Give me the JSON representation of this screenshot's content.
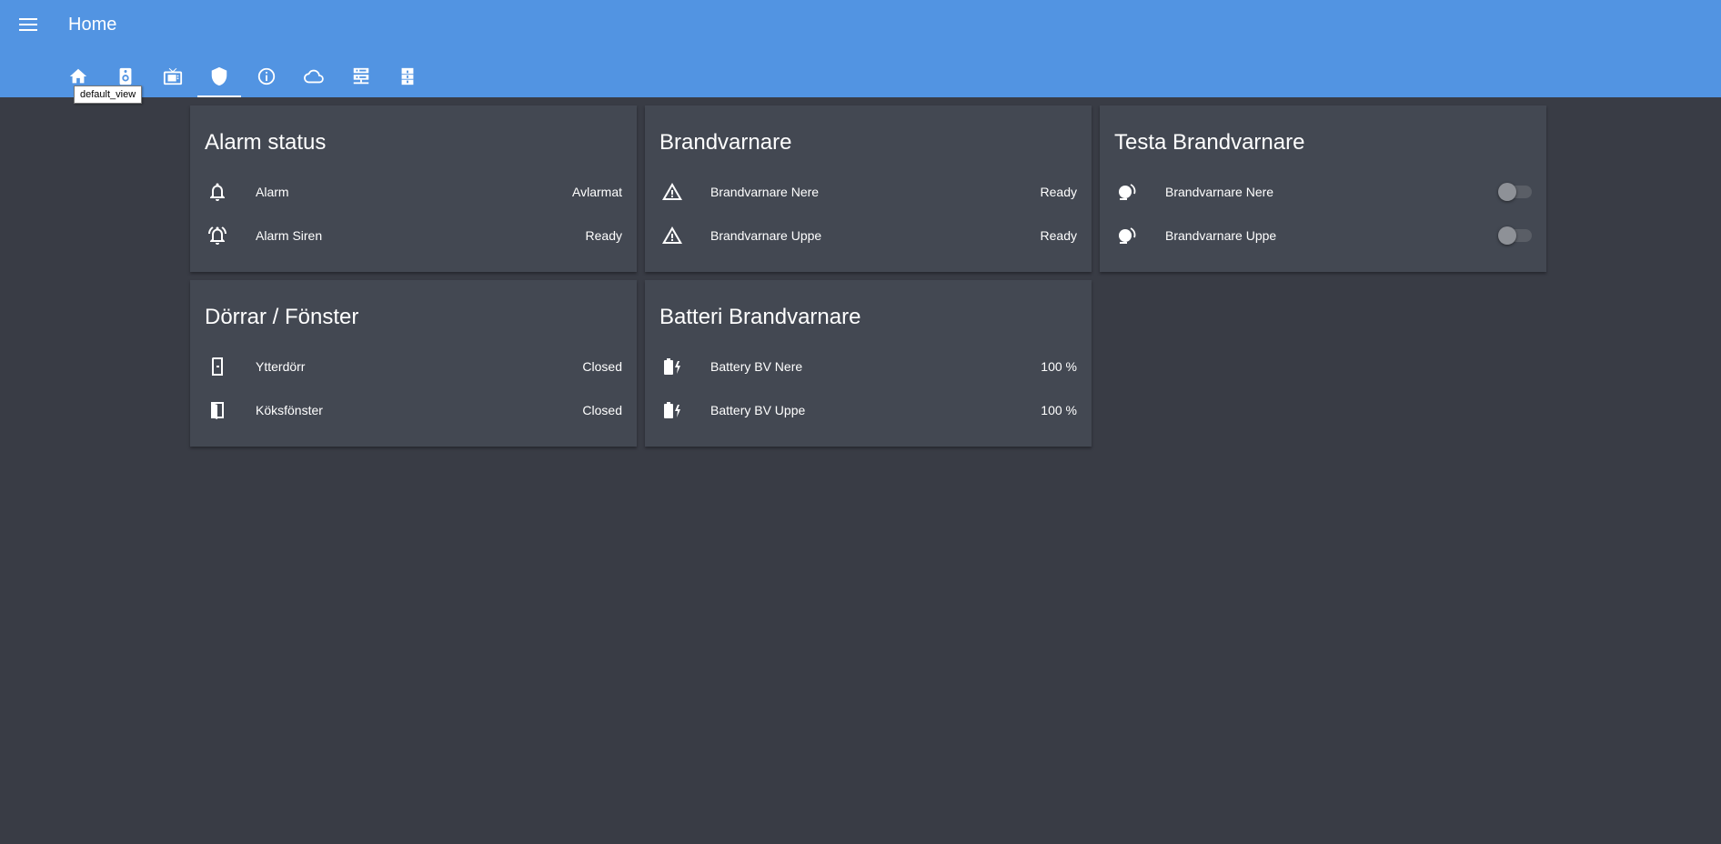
{
  "header": {
    "title": "Home",
    "menu_icon": "menu-icon",
    "tabs": [
      {
        "icon": "home-icon"
      },
      {
        "icon": "speaker-icon"
      },
      {
        "icon": "tv-icon"
      },
      {
        "icon": "shield-icon",
        "active": true
      },
      {
        "icon": "info-icon"
      },
      {
        "icon": "cloud-icon"
      },
      {
        "icon": "server-icon"
      },
      {
        "icon": "file-cabinet-icon"
      }
    ],
    "tooltip": "default_view"
  },
  "cards": {
    "alarm_status": {
      "title": "Alarm status",
      "rows": [
        {
          "icon": "bell-icon",
          "name": "Alarm",
          "state": "Avlarmat"
        },
        {
          "icon": "bell-ring-icon",
          "name": "Alarm Siren",
          "state": "Ready"
        }
      ]
    },
    "brandvarnare": {
      "title": "Brandvarnare",
      "rows": [
        {
          "icon": "warning-icon",
          "name": "Brandvarnare Nere",
          "state": "Ready"
        },
        {
          "icon": "warning-icon",
          "name": "Brandvarnare Uppe",
          "state": "Ready"
        }
      ]
    },
    "testa_brandvarnare": {
      "title": "Testa Brandvarnare",
      "rows": [
        {
          "icon": "gong-icon",
          "name": "Brandvarnare Nere",
          "toggle": "off"
        },
        {
          "icon": "gong-icon",
          "name": "Brandvarnare Uppe",
          "toggle": "off"
        }
      ]
    },
    "dorrar_fonster": {
      "title": "Dörrar / Fönster",
      "rows": [
        {
          "icon": "door-closed-icon",
          "name": "Ytterdörr",
          "state": "Closed"
        },
        {
          "icon": "window-closed-icon",
          "name": "Köksfönster",
          "state": "Closed"
        }
      ]
    },
    "batteri_brandvarnare": {
      "title": "Batteri Brandvarnare",
      "rows": [
        {
          "icon": "battery-charging-icon",
          "name": "Battery BV Nere",
          "state": "100 %"
        },
        {
          "icon": "battery-charging-icon",
          "name": "Battery BV Uppe",
          "state": "100 %"
        }
      ]
    }
  },
  "colors": {
    "header": "#5294e2",
    "background": "#393c45",
    "card": "#434852",
    "text": "#ffffff"
  }
}
